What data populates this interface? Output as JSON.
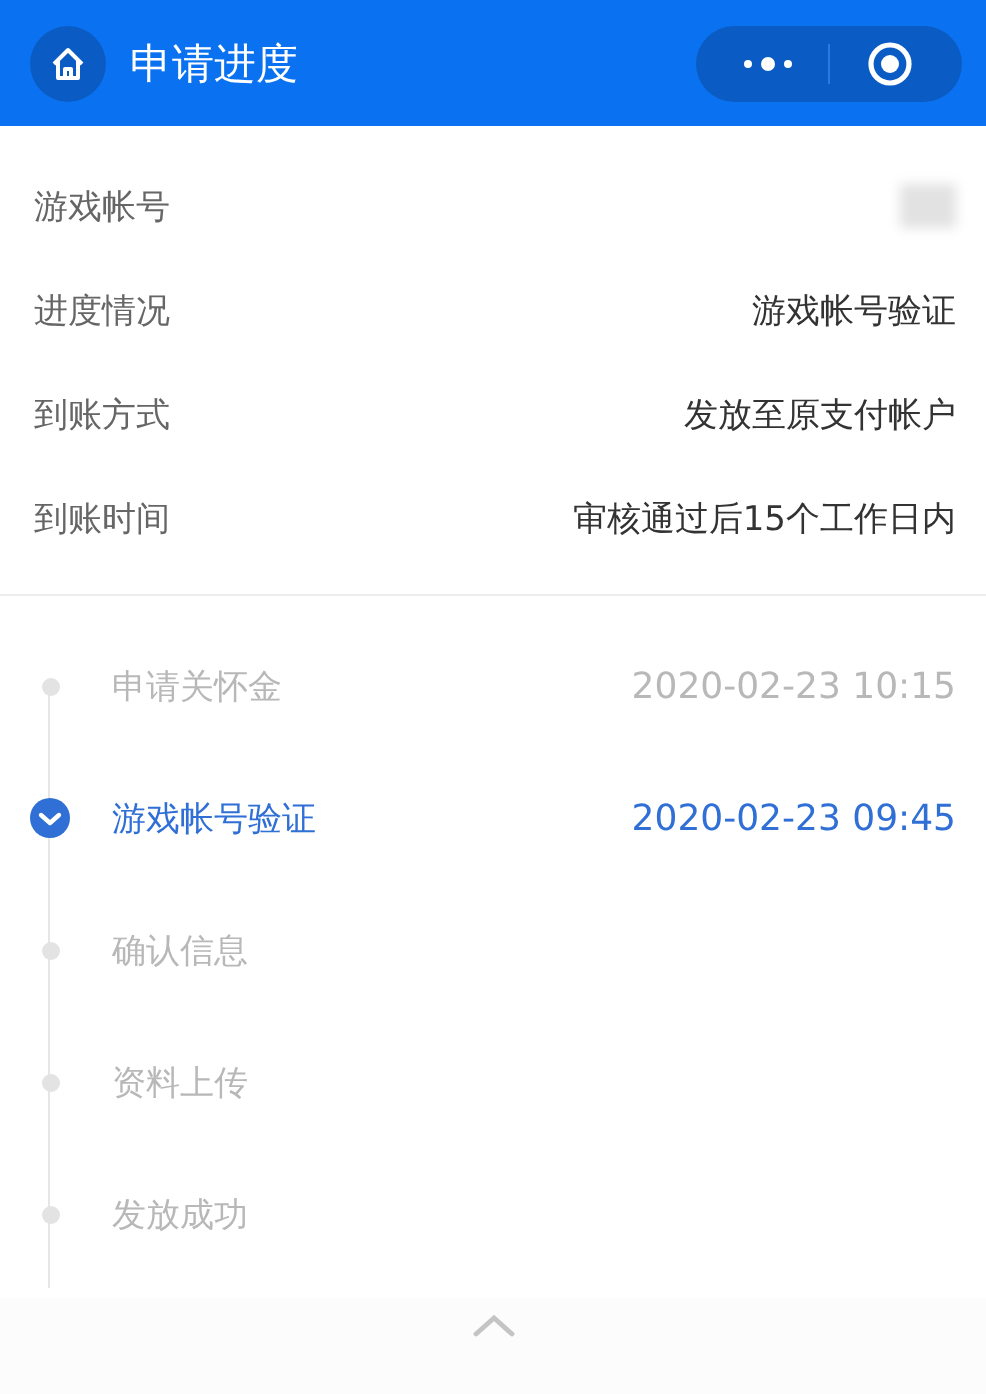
{
  "header": {
    "title": "申请进度"
  },
  "details": [
    {
      "label": "游戏帐号",
      "kind": "hidden"
    },
    {
      "label": "进度情况",
      "kind": "text",
      "value": "游戏帐号验证"
    },
    {
      "label": "到账方式",
      "kind": "text",
      "value": "发放至原支付帐户"
    },
    {
      "label": "到账时间",
      "kind": "text",
      "value": "审核通过后15个工作日内"
    }
  ],
  "steps": [
    {
      "name": "申请关怀金",
      "time": "2020-02-23 10:15",
      "current": false
    },
    {
      "name": "游戏帐号验证",
      "time": "2020-02-23 09:45",
      "current": true
    },
    {
      "name": "确认信息",
      "current": false
    },
    {
      "name": "资料上传",
      "current": false
    },
    {
      "name": "发放成功",
      "current": false
    }
  ]
}
